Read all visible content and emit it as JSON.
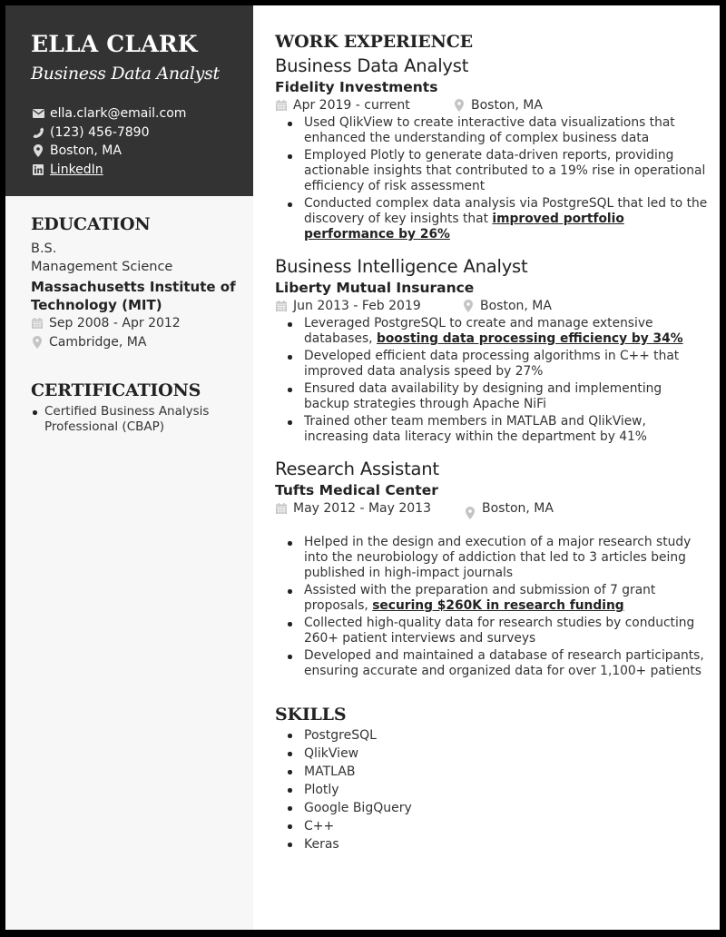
{
  "header": {
    "name": "ELLA CLARK",
    "title": "Business Data Analyst",
    "contacts": [
      {
        "icon": "envelope-icon",
        "text": "ella.clark@email.com",
        "link": false
      },
      {
        "icon": "phone-icon",
        "text": "(123) 456-7890",
        "link": false
      },
      {
        "icon": "map-pin-icon",
        "text": "Boston, MA",
        "link": false
      },
      {
        "icon": "linkedin-icon",
        "text": "LinkedIn",
        "link": true
      }
    ]
  },
  "education": {
    "heading": "EDUCATION",
    "degree": "B.S.",
    "field": "Management Science",
    "school": "Massachusetts Institute of Technology (MIT)",
    "dates": "Sep 2008 - Apr 2012",
    "location": "Cambridge, MA"
  },
  "certifications": {
    "heading": "CERTIFICATIONS",
    "items": [
      "Certified Business Analysis Professional (CBAP)"
    ]
  },
  "work": {
    "heading": "WORK EXPERIENCE",
    "jobs": [
      {
        "title": "Business Data Analyst",
        "company": "Fidelity Investments",
        "dates": "Apr 2019 - current",
        "location": "Boston, MA",
        "bullets": [
          {
            "text": "Used QlikView to create interactive data visualizations that enhanced the understanding of complex business data",
            "highlight": ""
          },
          {
            "text": "Employed Plotly to generate data-driven reports, providing actionable insights that contributed to a 19% rise in operational efficiency of risk assessment",
            "highlight": ""
          },
          {
            "text": "Conducted complex data analysis via PostgreSQL that led to the discovery of key insights that ",
            "highlight": "improved portfolio performance by 26%"
          }
        ]
      },
      {
        "title": "Business Intelligence Analyst",
        "company": "Liberty Mutual Insurance",
        "dates": "Jun 2013 - Feb 2019",
        "location": "Boston, MA",
        "bullets": [
          {
            "text": "Leveraged PostgreSQL to create and manage extensive databases, ",
            "highlight": "boosting data processing efficiency by 34%"
          },
          {
            "text": "Developed efficient data processing algorithms in C++ that improved data analysis speed by 27%",
            "highlight": ""
          },
          {
            "text": "Ensured data availability by designing and implementing backup strategies through Apache NiFi",
            "highlight": ""
          },
          {
            "text": "Trained other team members in MATLAB and QlikView, increasing data literacy within the department by 41%",
            "highlight": ""
          }
        ]
      },
      {
        "title": "Research Assistant",
        "company": "Tufts Medical Center",
        "dates": "May 2012 - May 2013",
        "location": "Boston, MA",
        "bullets": [
          {
            "text": "Helped in the design and execution of a major research study into the neurobiology of addiction that led to 3 articles being published in high-impact journals",
            "highlight": ""
          },
          {
            "text": "Assisted with the preparation and submission of 7 grant proposals, ",
            "highlight": "securing $260K in research funding"
          },
          {
            "text": "Collected high-quality data for research studies by conducting 260+ patient interviews and surveys",
            "highlight": ""
          },
          {
            "text": "Developed and maintained a database of research participants, ensuring accurate and organized data for over 1,100+ patients",
            "highlight": ""
          }
        ]
      }
    ]
  },
  "skills": {
    "heading": "SKILLS",
    "items": [
      "PostgreSQL",
      "QlikView",
      "MATLAB",
      "Plotly",
      "Google BigQuery",
      "C++",
      "Keras"
    ]
  },
  "colors": {
    "sidebar_header_bg": "#333333",
    "sidebar_bg": "#f7f7f7",
    "icon_gray": "#c4c4c4",
    "text_dark": "#222222"
  }
}
